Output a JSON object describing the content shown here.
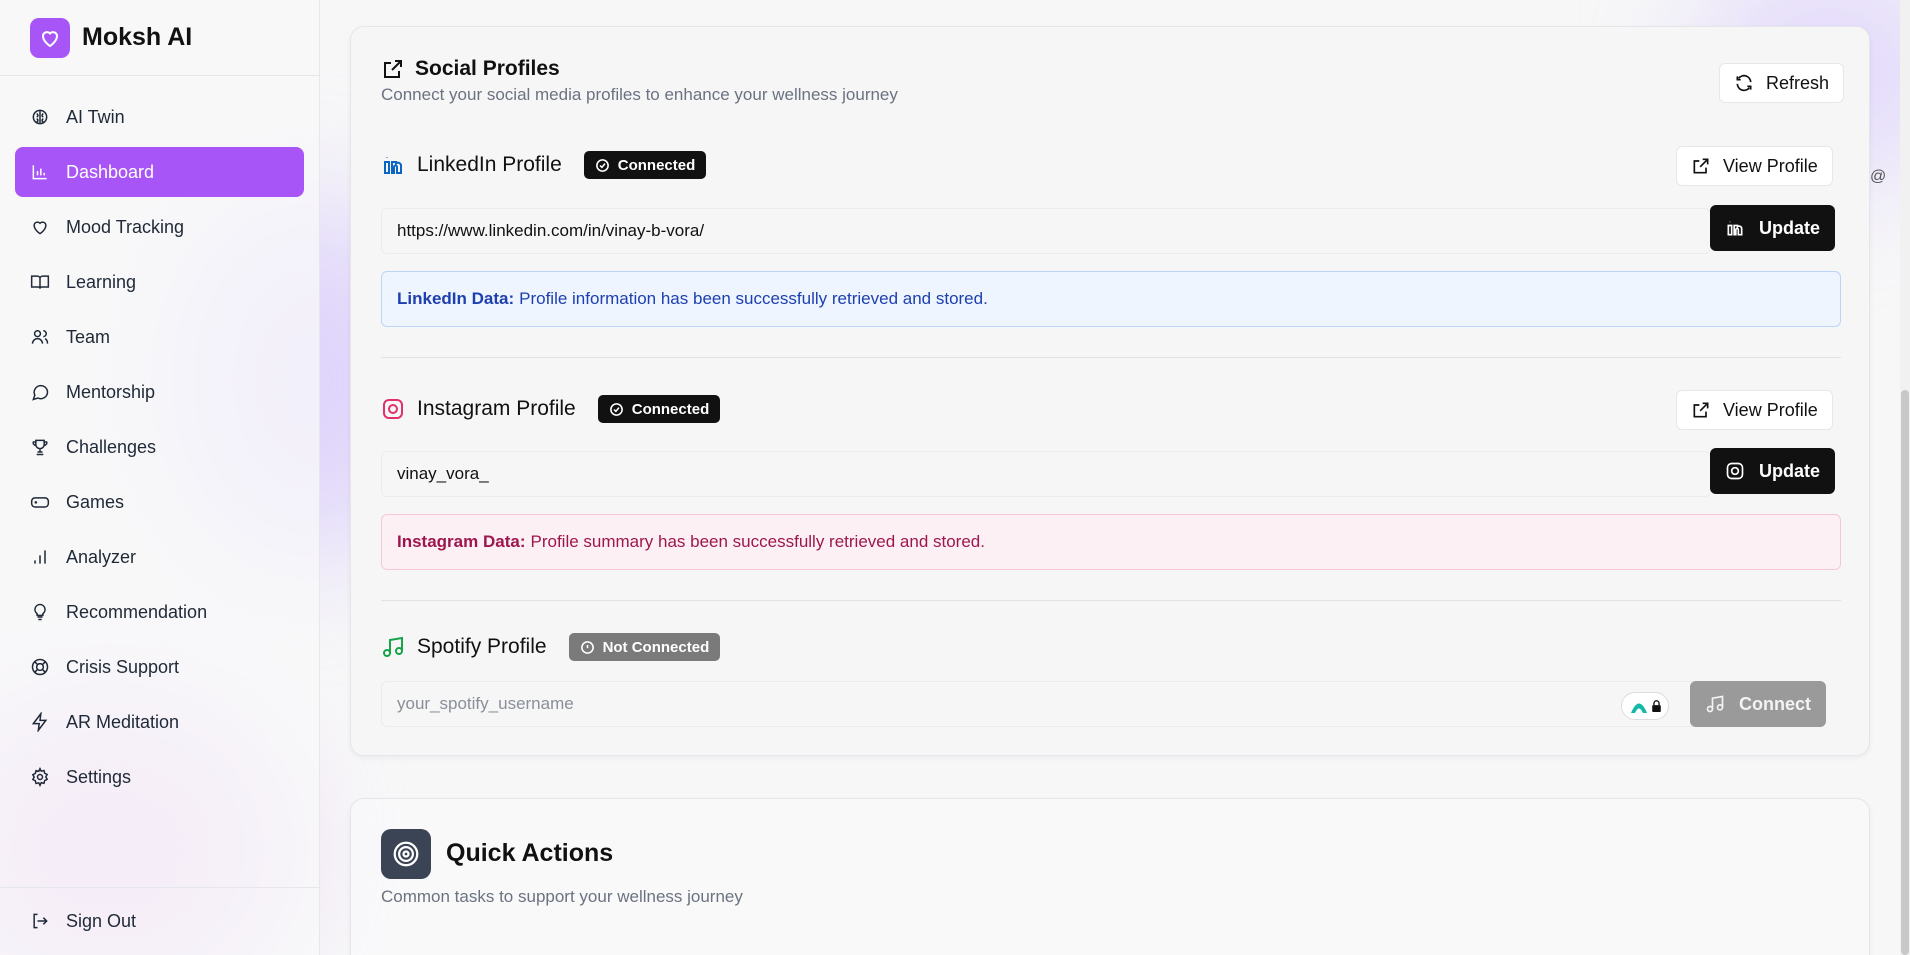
{
  "brand": {
    "name": "Moksh AI"
  },
  "nav": {
    "items": [
      {
        "label": "AI Twin",
        "icon": "brain-icon"
      },
      {
        "label": "Dashboard",
        "icon": "bar-chart-icon",
        "active": true
      },
      {
        "label": "Mood Tracking",
        "icon": "heart-icon"
      },
      {
        "label": "Learning",
        "icon": "book-open-icon"
      },
      {
        "label": "Team",
        "icon": "users-icon"
      },
      {
        "label": "Mentorship",
        "icon": "message-circle-icon"
      },
      {
        "label": "Challenges",
        "icon": "trophy-icon"
      },
      {
        "label": "Games",
        "icon": "gamepad-icon"
      },
      {
        "label": "Analyzer",
        "icon": "signal-bars-icon"
      },
      {
        "label": "Recommendation",
        "icon": "lightbulb-icon"
      },
      {
        "label": "Crisis Support",
        "icon": "life-buoy-icon"
      },
      {
        "label": "AR Meditation",
        "icon": "zap-icon"
      },
      {
        "label": "Settings",
        "icon": "gear-icon"
      }
    ],
    "sign_out": "Sign Out"
  },
  "social": {
    "title": "Social Profiles",
    "subtitle": "Connect your social media profiles to enhance your wellness journey",
    "refresh": "Refresh",
    "linkedin": {
      "name": "LinkedIn Profile",
      "status": "Connected",
      "view": "View Profile",
      "value": "https://www.linkedin.com/in/vinay-b-vora/",
      "update": "Update",
      "info_label": "LinkedIn Data:",
      "info_text": "Profile information has been successfully retrieved and stored."
    },
    "instagram": {
      "name": "Instagram Profile",
      "status": "Connected",
      "view": "View Profile",
      "value": "vinay_vora_",
      "update": "Update",
      "info_label": "Instagram Data:",
      "info_text": "Profile summary has been successfully retrieved and stored."
    },
    "spotify": {
      "name": "Spotify Profile",
      "status": "Not Connected",
      "placeholder": "your_spotify_username",
      "connect": "Connect"
    }
  },
  "quick": {
    "title": "Quick Actions",
    "subtitle": "Common tasks to support your wellness journey"
  },
  "misc": {
    "at": "@"
  },
  "colors": {
    "accent": "#a855f7",
    "linkedin": "#0a66c2",
    "instagram": "#e1306c",
    "spotify": "#1db954"
  }
}
